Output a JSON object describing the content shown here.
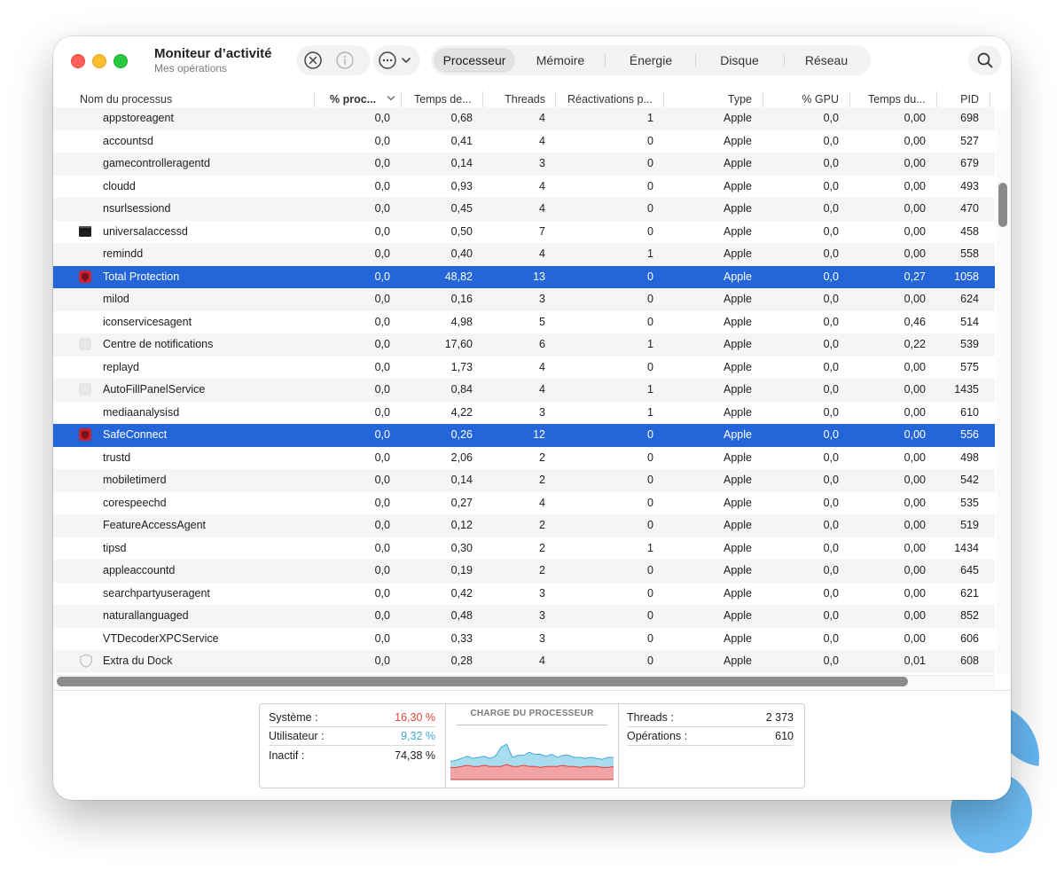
{
  "app": {
    "title": "Moniteur d’activité",
    "subtitle": "Mes opérations"
  },
  "toolbar": {
    "icons": [
      "stop-process-icon",
      "info-icon",
      "more-icon",
      "search-icon"
    ]
  },
  "tabs": [
    {
      "label": "Processeur",
      "active": true
    },
    {
      "label": "Mémoire",
      "active": false
    },
    {
      "label": "Énergie",
      "active": false
    },
    {
      "label": "Disque",
      "active": false
    },
    {
      "label": "Réseau",
      "active": false
    }
  ],
  "table": {
    "columns": [
      "Nom du processus",
      "% proc...",
      "Temps de...",
      "Threads",
      "Réactivations p...",
      "Type",
      "% GPU",
      "Temps du...",
      "PID"
    ],
    "rows": [
      {
        "name": "appstoreagent",
        "cpu": "0,0",
        "time": "0,68",
        "threads": "4",
        "wakeups": "1",
        "type": "Apple",
        "gpu": "0,0",
        "gtime": "0,00",
        "pid": "698",
        "icon": "none",
        "selected": false
      },
      {
        "name": "accountsd",
        "cpu": "0,0",
        "time": "0,41",
        "threads": "4",
        "wakeups": "0",
        "type": "Apple",
        "gpu": "0,0",
        "gtime": "0,00",
        "pid": "527",
        "icon": "none",
        "selected": false
      },
      {
        "name": "gamecontrolleragentd",
        "cpu": "0,0",
        "time": "0,14",
        "threads": "3",
        "wakeups": "0",
        "type": "Apple",
        "gpu": "0,0",
        "gtime": "0,00",
        "pid": "679",
        "icon": "none",
        "selected": false
      },
      {
        "name": "cloudd",
        "cpu": "0,0",
        "time": "0,93",
        "threads": "4",
        "wakeups": "0",
        "type": "Apple",
        "gpu": "0,0",
        "gtime": "0,00",
        "pid": "493",
        "icon": "none",
        "selected": false
      },
      {
        "name": "nsurlsessiond",
        "cpu": "0,0",
        "time": "0,45",
        "threads": "4",
        "wakeups": "0",
        "type": "Apple",
        "gpu": "0,0",
        "gtime": "0,00",
        "pid": "470",
        "icon": "none",
        "selected": false
      },
      {
        "name": "universalaccessd",
        "cpu": "0,0",
        "time": "0,50",
        "threads": "7",
        "wakeups": "0",
        "type": "Apple",
        "gpu": "0,0",
        "gtime": "0,00",
        "pid": "458",
        "icon": "terminal",
        "selected": false
      },
      {
        "name": "remindd",
        "cpu": "0,0",
        "time": "0,40",
        "threads": "4",
        "wakeups": "1",
        "type": "Apple",
        "gpu": "0,0",
        "gtime": "0,00",
        "pid": "558",
        "icon": "none",
        "selected": false
      },
      {
        "name": "Total Protection",
        "cpu": "0,0",
        "time": "48,82",
        "threads": "13",
        "wakeups": "0",
        "type": "Apple",
        "gpu": "0,0",
        "gtime": "0,27",
        "pid": "1058",
        "icon": "shield",
        "selected": true
      },
      {
        "name": "milod",
        "cpu": "0,0",
        "time": "0,16",
        "threads": "3",
        "wakeups": "0",
        "type": "Apple",
        "gpu": "0,0",
        "gtime": "0,00",
        "pid": "624",
        "icon": "none",
        "selected": false
      },
      {
        "name": "iconservicesagent",
        "cpu": "0,0",
        "time": "4,98",
        "threads": "5",
        "wakeups": "0",
        "type": "Apple",
        "gpu": "0,0",
        "gtime": "0,46",
        "pid": "514",
        "icon": "none",
        "selected": false
      },
      {
        "name": "Centre de notifications",
        "cpu": "0,0",
        "time": "17,60",
        "threads": "6",
        "wakeups": "1",
        "type": "Apple",
        "gpu": "0,0",
        "gtime": "0,22",
        "pid": "539",
        "icon": "blank",
        "selected": false
      },
      {
        "name": "replayd",
        "cpu": "0,0",
        "time": "1,73",
        "threads": "4",
        "wakeups": "0",
        "type": "Apple",
        "gpu": "0,0",
        "gtime": "0,00",
        "pid": "575",
        "icon": "none",
        "selected": false
      },
      {
        "name": "AutoFillPanelService",
        "cpu": "0,0",
        "time": "0,84",
        "threads": "4",
        "wakeups": "1",
        "type": "Apple",
        "gpu": "0,0",
        "gtime": "0,00",
        "pid": "1435",
        "icon": "blank",
        "selected": false
      },
      {
        "name": "mediaanalysisd",
        "cpu": "0,0",
        "time": "4,22",
        "threads": "3",
        "wakeups": "1",
        "type": "Apple",
        "gpu": "0,0",
        "gtime": "0,00",
        "pid": "610",
        "icon": "none",
        "selected": false
      },
      {
        "name": "SafeConnect",
        "cpu": "0,0",
        "time": "0,26",
        "threads": "12",
        "wakeups": "0",
        "type": "Apple",
        "gpu": "0,0",
        "gtime": "0,00",
        "pid": "556",
        "icon": "shield",
        "selected": true
      },
      {
        "name": "trustd",
        "cpu": "0,0",
        "time": "2,06",
        "threads": "2",
        "wakeups": "0",
        "type": "Apple",
        "gpu": "0,0",
        "gtime": "0,00",
        "pid": "498",
        "icon": "none",
        "selected": false
      },
      {
        "name": "mobiletimerd",
        "cpu": "0,0",
        "time": "0,14",
        "threads": "2",
        "wakeups": "0",
        "type": "Apple",
        "gpu": "0,0",
        "gtime": "0,00",
        "pid": "542",
        "icon": "none",
        "selected": false
      },
      {
        "name": "corespeechd",
        "cpu": "0,0",
        "time": "0,27",
        "threads": "4",
        "wakeups": "0",
        "type": "Apple",
        "gpu": "0,0",
        "gtime": "0,00",
        "pid": "535",
        "icon": "none",
        "selected": false
      },
      {
        "name": "FeatureAccessAgent",
        "cpu": "0,0",
        "time": "0,12",
        "threads": "2",
        "wakeups": "0",
        "type": "Apple",
        "gpu": "0,0",
        "gtime": "0,00",
        "pid": "519",
        "icon": "none",
        "selected": false
      },
      {
        "name": "tipsd",
        "cpu": "0,0",
        "time": "0,30",
        "threads": "2",
        "wakeups": "1",
        "type": "Apple",
        "gpu": "0,0",
        "gtime": "0,00",
        "pid": "1434",
        "icon": "none",
        "selected": false
      },
      {
        "name": "appleaccountd",
        "cpu": "0,0",
        "time": "0,19",
        "threads": "2",
        "wakeups": "0",
        "type": "Apple",
        "gpu": "0,0",
        "gtime": "0,00",
        "pid": "645",
        "icon": "none",
        "selected": false
      },
      {
        "name": "searchpartyuseragent",
        "cpu": "0,0",
        "time": "0,42",
        "threads": "3",
        "wakeups": "0",
        "type": "Apple",
        "gpu": "0,0",
        "gtime": "0,00",
        "pid": "621",
        "icon": "none",
        "selected": false
      },
      {
        "name": "naturallanguaged",
        "cpu": "0,0",
        "time": "0,48",
        "threads": "3",
        "wakeups": "0",
        "type": "Apple",
        "gpu": "0,0",
        "gtime": "0,00",
        "pid": "852",
        "icon": "none",
        "selected": false
      },
      {
        "name": "VTDecoderXPCService",
        "cpu": "0,0",
        "time": "0,33",
        "threads": "3",
        "wakeups": "0",
        "type": "Apple",
        "gpu": "0,0",
        "gtime": "0,00",
        "pid": "606",
        "icon": "none",
        "selected": false
      },
      {
        "name": "Extra du Dock",
        "cpu": "0,0",
        "time": "0,28",
        "threads": "4",
        "wakeups": "0",
        "type": "Apple",
        "gpu": "0,0",
        "gtime": "0,01",
        "pid": "608",
        "icon": "shield-outline",
        "selected": false
      }
    ]
  },
  "footer": {
    "system_label": "Système :",
    "system_value": "16,30 %",
    "user_label": "Utilisateur :",
    "user_value": "9,32 %",
    "idle_label": "Inactif :",
    "idle_value": "74,38 %",
    "chart_title": "CHARGE DU PROCESSEUR",
    "threads_label": "Threads :",
    "threads_value": "2 373",
    "processes_label": "Opérations :",
    "processes_value": "610"
  },
  "colors": {
    "selection": "#2466da",
    "system": "#e0443e",
    "user": "#3fa8d8",
    "system_fill": "#f1a3a6",
    "user_fill": "#a9dcef"
  },
  "chart_data": {
    "type": "area",
    "title": "CHARGE DU PROCESSEUR",
    "ylim": [
      0,
      100
    ],
    "series": [
      {
        "name": "Système :",
        "values": [
          12,
          12,
          13,
          14,
          13,
          13,
          14,
          13,
          13,
          13,
          15,
          13,
          13,
          14,
          13,
          13,
          12,
          13,
          13,
          13,
          14,
          13,
          13,
          12,
          13,
          13,
          13,
          12,
          12,
          13
        ]
      },
      {
        "name": "Utilisateur :",
        "values": [
          6,
          7,
          8,
          9,
          8,
          9,
          9,
          8,
          10,
          19,
          20,
          9,
          11,
          10,
          14,
          12,
          13,
          10,
          12,
          9,
          10,
          11,
          9,
          10,
          8,
          9,
          8,
          8,
          10,
          9
        ]
      }
    ]
  }
}
